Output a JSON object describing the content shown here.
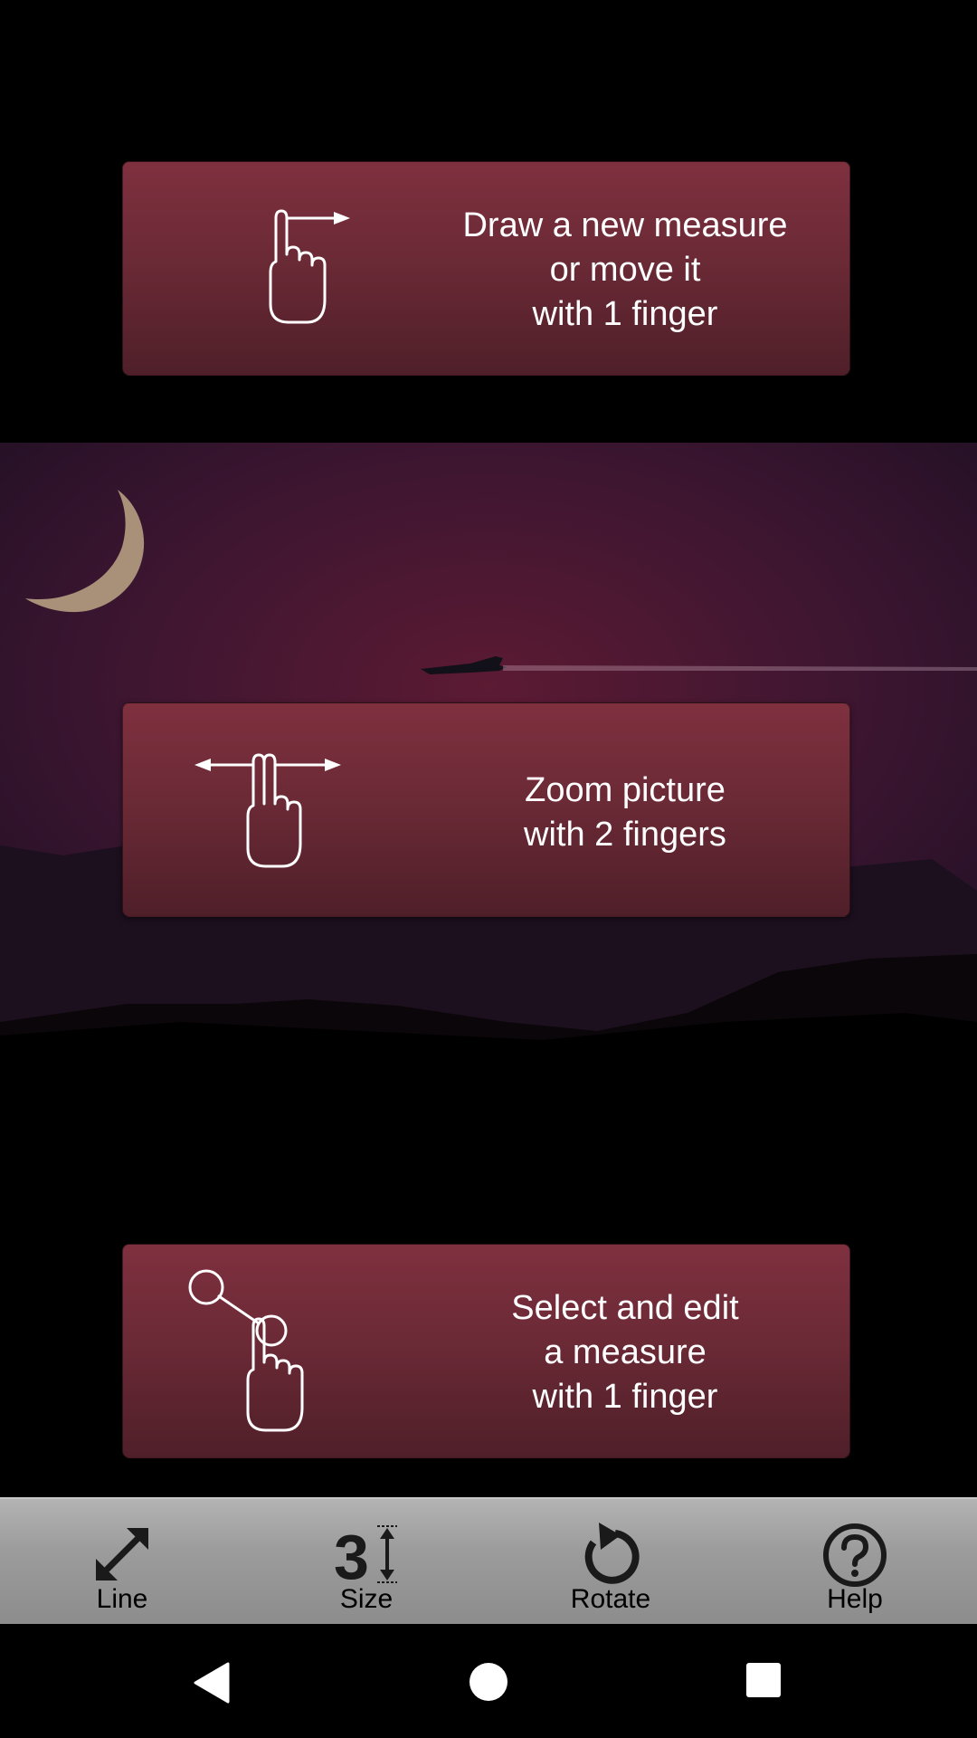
{
  "cards": [
    {
      "text": "Draw a new measure\nor move it\nwith 1 finger",
      "gesture": "one-finger-drag-icon"
    },
    {
      "text": "Zoom picture\nwith 2 fingers",
      "gesture": "two-finger-pinch-icon"
    },
    {
      "text": "Select and edit\na measure\nwith 1 finger",
      "gesture": "one-finger-select-icon"
    }
  ],
  "toolbar": {
    "line_label": "Line",
    "size_label": "Size",
    "size_digit": "3",
    "rotate_label": "Rotate",
    "help_label": "Help"
  },
  "colors": {
    "card_top": "#7f303f",
    "card_bottom": "#4f1f29",
    "sky": "#5a1a35",
    "moon": "#a89178",
    "toolbar": "#9c9c9c"
  }
}
